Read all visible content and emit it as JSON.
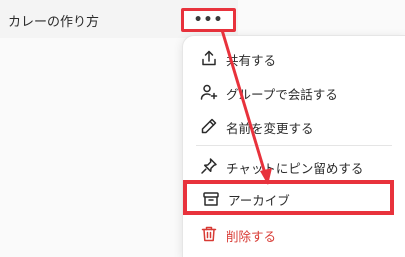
{
  "chat": {
    "title": "カレーの作り方",
    "more_label": "•••"
  },
  "menu": {
    "items": [
      {
        "label": "共有する",
        "icon": "share-icon"
      },
      {
        "label": "グループで会話する",
        "icon": "add-person-icon"
      },
      {
        "label": "名前を変更する",
        "icon": "pencil-icon"
      },
      {
        "label": "チャットにピン留めする",
        "icon": "pin-icon"
      },
      {
        "label": "アーカイブ",
        "icon": "archive-icon"
      },
      {
        "label": "削除する",
        "icon": "trash-icon"
      }
    ]
  },
  "colors": {
    "highlight": "#e8323c",
    "danger": "#d83a34",
    "text": "#2b2b2b"
  }
}
